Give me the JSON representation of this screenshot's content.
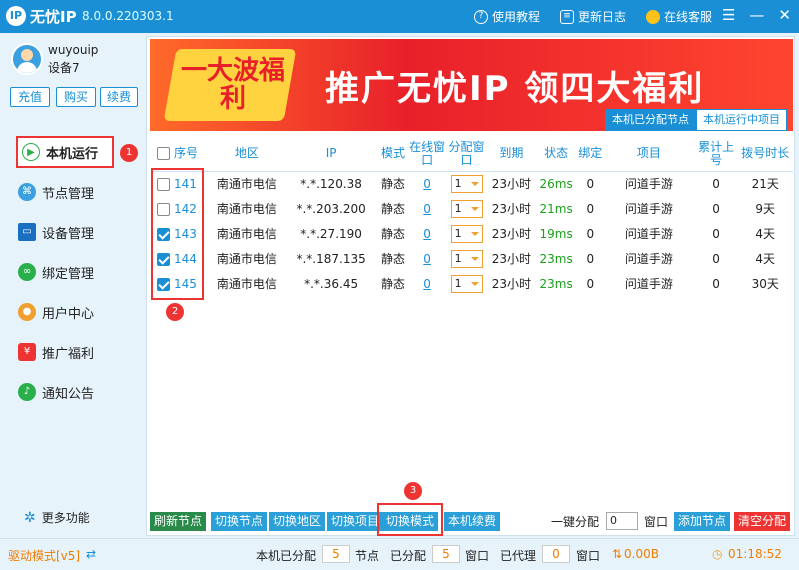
{
  "titlebar": {
    "app_name": "无忧IP",
    "version": "8.0.0.220303.1",
    "logo_text": "IP",
    "tutorial": "使用教程",
    "changelog": "更新日志",
    "support": "在线客服"
  },
  "user": {
    "name": "wuyouip",
    "device": "设备7"
  },
  "account_buttons": [
    "充值",
    "购买",
    "续费"
  ],
  "nav": [
    "本机运行",
    "节点管理",
    "设备管理",
    "绑定管理",
    "用户中心",
    "推广福利",
    "通知公告"
  ],
  "more": "更多功能",
  "markers": [
    "1",
    "2",
    "3"
  ],
  "banner": {
    "badge": "一大波福利",
    "main": "推广无忧IP 领四大福利",
    "tabs": [
      "本机已分配节点",
      "本机运行中项目"
    ]
  },
  "table": {
    "headers": [
      "序号",
      "地区",
      "IP",
      "模式",
      "在线窗口",
      "分配窗口",
      "到期",
      "状态",
      "绑定",
      "项目",
      "累计上号",
      "拨号时长"
    ],
    "rows": [
      {
        "checked": false,
        "id": "141",
        "region": "南通市电信",
        "ip": "*.*.120.38",
        "mode": "静态",
        "online": "0",
        "alloc": "1",
        "expire": "23小时",
        "status": "26ms",
        "bind": "0",
        "project": "问道手游",
        "total": "0",
        "duration": "21天"
      },
      {
        "checked": false,
        "id": "142",
        "region": "南通市电信",
        "ip": "*.*.203.200",
        "mode": "静态",
        "online": "0",
        "alloc": "1",
        "expire": "23小时",
        "status": "21ms",
        "bind": "0",
        "project": "问道手游",
        "total": "0",
        "duration": "9天"
      },
      {
        "checked": true,
        "id": "143",
        "region": "南通市电信",
        "ip": "*.*.27.190",
        "mode": "静态",
        "online": "0",
        "alloc": "1",
        "expire": "23小时",
        "status": "19ms",
        "bind": "0",
        "project": "问道手游",
        "total": "0",
        "duration": "4天"
      },
      {
        "checked": true,
        "id": "144",
        "region": "南通市电信",
        "ip": "*.*.187.135",
        "mode": "静态",
        "online": "0",
        "alloc": "1",
        "expire": "23小时",
        "status": "23ms",
        "bind": "0",
        "project": "问道手游",
        "total": "0",
        "duration": "4天"
      },
      {
        "checked": true,
        "id": "145",
        "region": "南通市电信",
        "ip": "*.*.36.45",
        "mode": "静态",
        "online": "0",
        "alloc": "1",
        "expire": "23小时",
        "status": "23ms",
        "bind": "0",
        "project": "问道手游",
        "total": "0",
        "duration": "30天"
      }
    ]
  },
  "actions": {
    "refresh": "刷新节点",
    "switch_node": "切换节点",
    "switch_region": "切换地区",
    "switch_project": "切换项目",
    "switch_mode": "切换模式",
    "renew": "本机续费",
    "one_click": "一键分配",
    "one_click_value": "0",
    "window": "窗口",
    "add_node": "添加节点",
    "clear": "清空分配"
  },
  "status": {
    "driver": "驱动模式[v5]",
    "assigned_label": "本机已分配",
    "assigned": "5",
    "node": "节点",
    "allocated_label": "已分配",
    "allocated": "5",
    "window": "窗口",
    "proxied_label": "已代理",
    "proxied": "0",
    "window2": "窗口",
    "traffic": "0.00B",
    "time": "01:18:52"
  },
  "colors": {
    "accent": "#1a8fd6",
    "highlight": "#e33333",
    "ok": "#1aa01a"
  }
}
